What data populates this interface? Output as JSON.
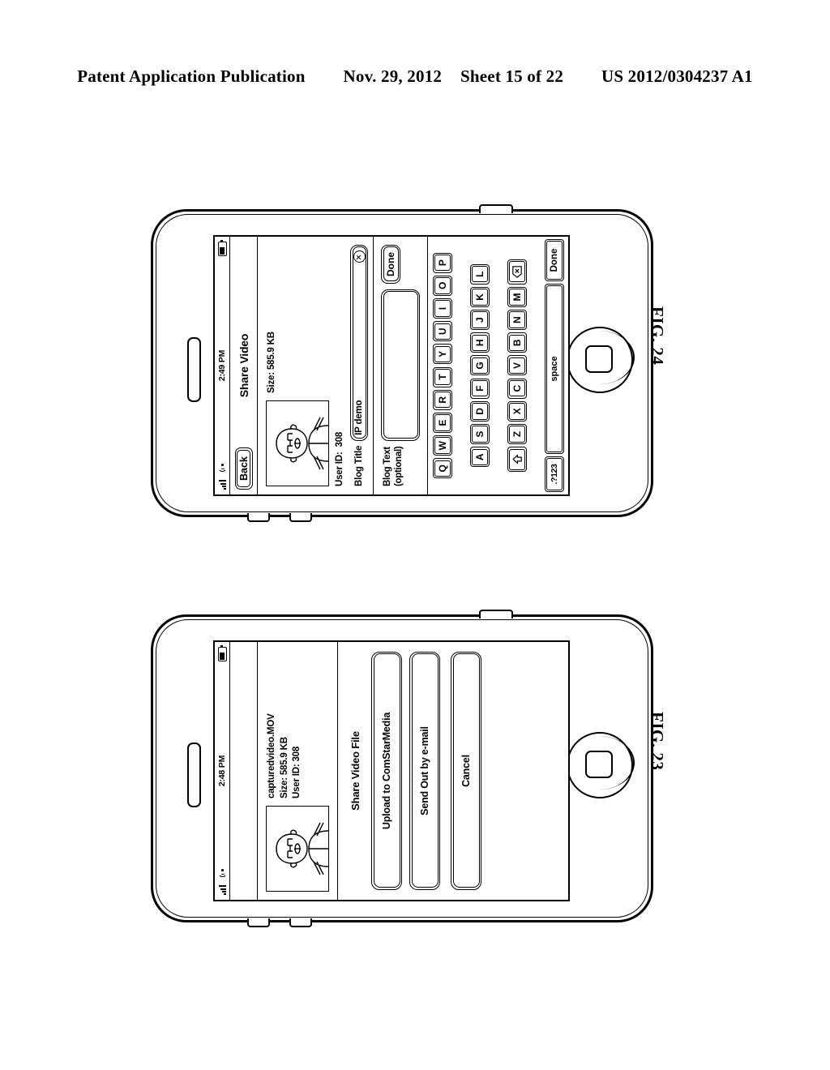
{
  "header": {
    "publication": "Patent Application Publication",
    "date": "Nov. 29, 2012",
    "sheet": "Sheet 15 of 22",
    "patent_number": "US 2012/0304237 A1"
  },
  "figures": {
    "fig24": {
      "caption": "FIG. 24",
      "status_bar": {
        "signal": "signal-bars-icon",
        "wifi": "wifi-icon",
        "time": "2:49 PM",
        "battery": "battery-icon"
      },
      "nav": {
        "back_label": "Back",
        "title": "Share Video"
      },
      "media": {
        "thumbnail": "person-video-thumbnail",
        "size_label": "Size: 585.9 KB"
      },
      "form": {
        "user_id_label": "User ID:",
        "user_id_value": "308",
        "blog_title_label": "Blog Title",
        "blog_title_value": "IP demo",
        "clear_icon": "clear-circle-x-icon",
        "blog_text_label_line1": "Blog Text",
        "blog_text_label_line2": "(optional)",
        "blog_text_value": "",
        "done_label": "Done"
      },
      "keyboard": {
        "row1": [
          "Q",
          "W",
          "E",
          "R",
          "T",
          "Y",
          "U",
          "I",
          "O",
          "P"
        ],
        "row2": [
          "A",
          "S",
          "D",
          "F",
          "G",
          "H",
          "J",
          "K",
          "L"
        ],
        "row3_letters": [
          "Z",
          "X",
          "C",
          "V",
          "B",
          "N",
          "M"
        ],
        "shift_icon": "shift-arrow-icon",
        "backspace_icon": "backspace-icon",
        "numeric_label": ".?123",
        "space_label": "space",
        "return_label": "Done"
      }
    },
    "fig23": {
      "caption": "FIG. 23",
      "status_bar": {
        "signal": "signal-bars-icon",
        "wifi": "wifi-icon",
        "time": "2:48 PM",
        "battery": "battery-icon"
      },
      "media": {
        "thumbnail": "person-video-thumbnail",
        "filename": "capturedvideo.MOV",
        "size_label": "Size: 585.9 KB",
        "user_id_label": "User ID: 308"
      },
      "action_sheet": {
        "title": "Share Video File",
        "buttons": [
          "Upload to ComStarMedia",
          "Send Out by e-mail",
          "Cancel"
        ]
      }
    }
  }
}
